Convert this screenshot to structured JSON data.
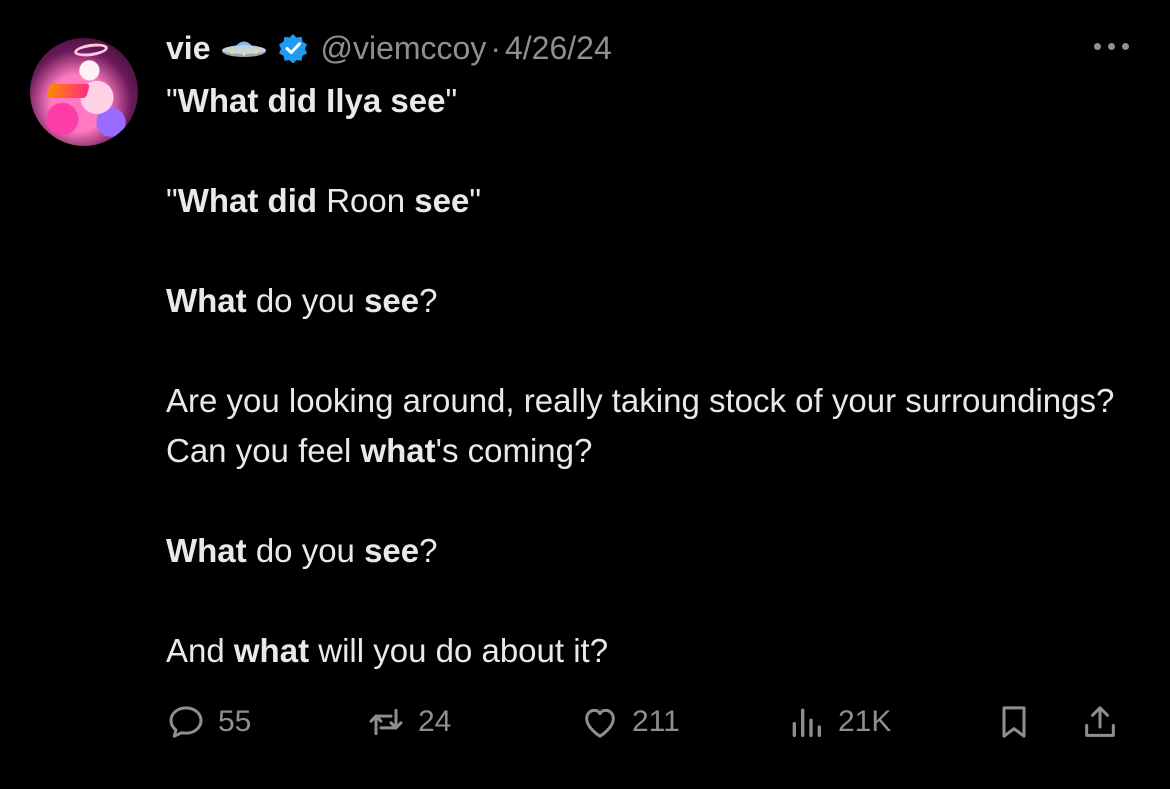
{
  "author": {
    "name": "vie",
    "handle": "@viemccoy",
    "separator": "·",
    "date": "4/26/24"
  },
  "icons": {
    "name_emoji": "ufo-icon",
    "verified": "verified-badge-icon",
    "more": "more-icon"
  },
  "colors": {
    "background": "#000000",
    "text": "#e7e9ea",
    "muted": "#8b9095",
    "verified": "#1d9bf0"
  },
  "body": {
    "p1": [
      "\"",
      "What did Ilya see",
      "\""
    ],
    "p2": [
      "\"",
      "What did",
      " Roon ",
      "see",
      "\""
    ],
    "p3": [
      "What",
      " do you ",
      "see",
      "?"
    ],
    "p4": [
      "Are you looking around, really taking stock of your surroundings? Can you feel ",
      "what",
      "'s coming?"
    ],
    "p5": [
      "What",
      " do you ",
      "see",
      "?"
    ],
    "p6": [
      "And ",
      "what",
      " will you do about it?"
    ]
  },
  "actions": {
    "replies": "55",
    "reposts": "24",
    "likes": "211",
    "views": "21K"
  }
}
